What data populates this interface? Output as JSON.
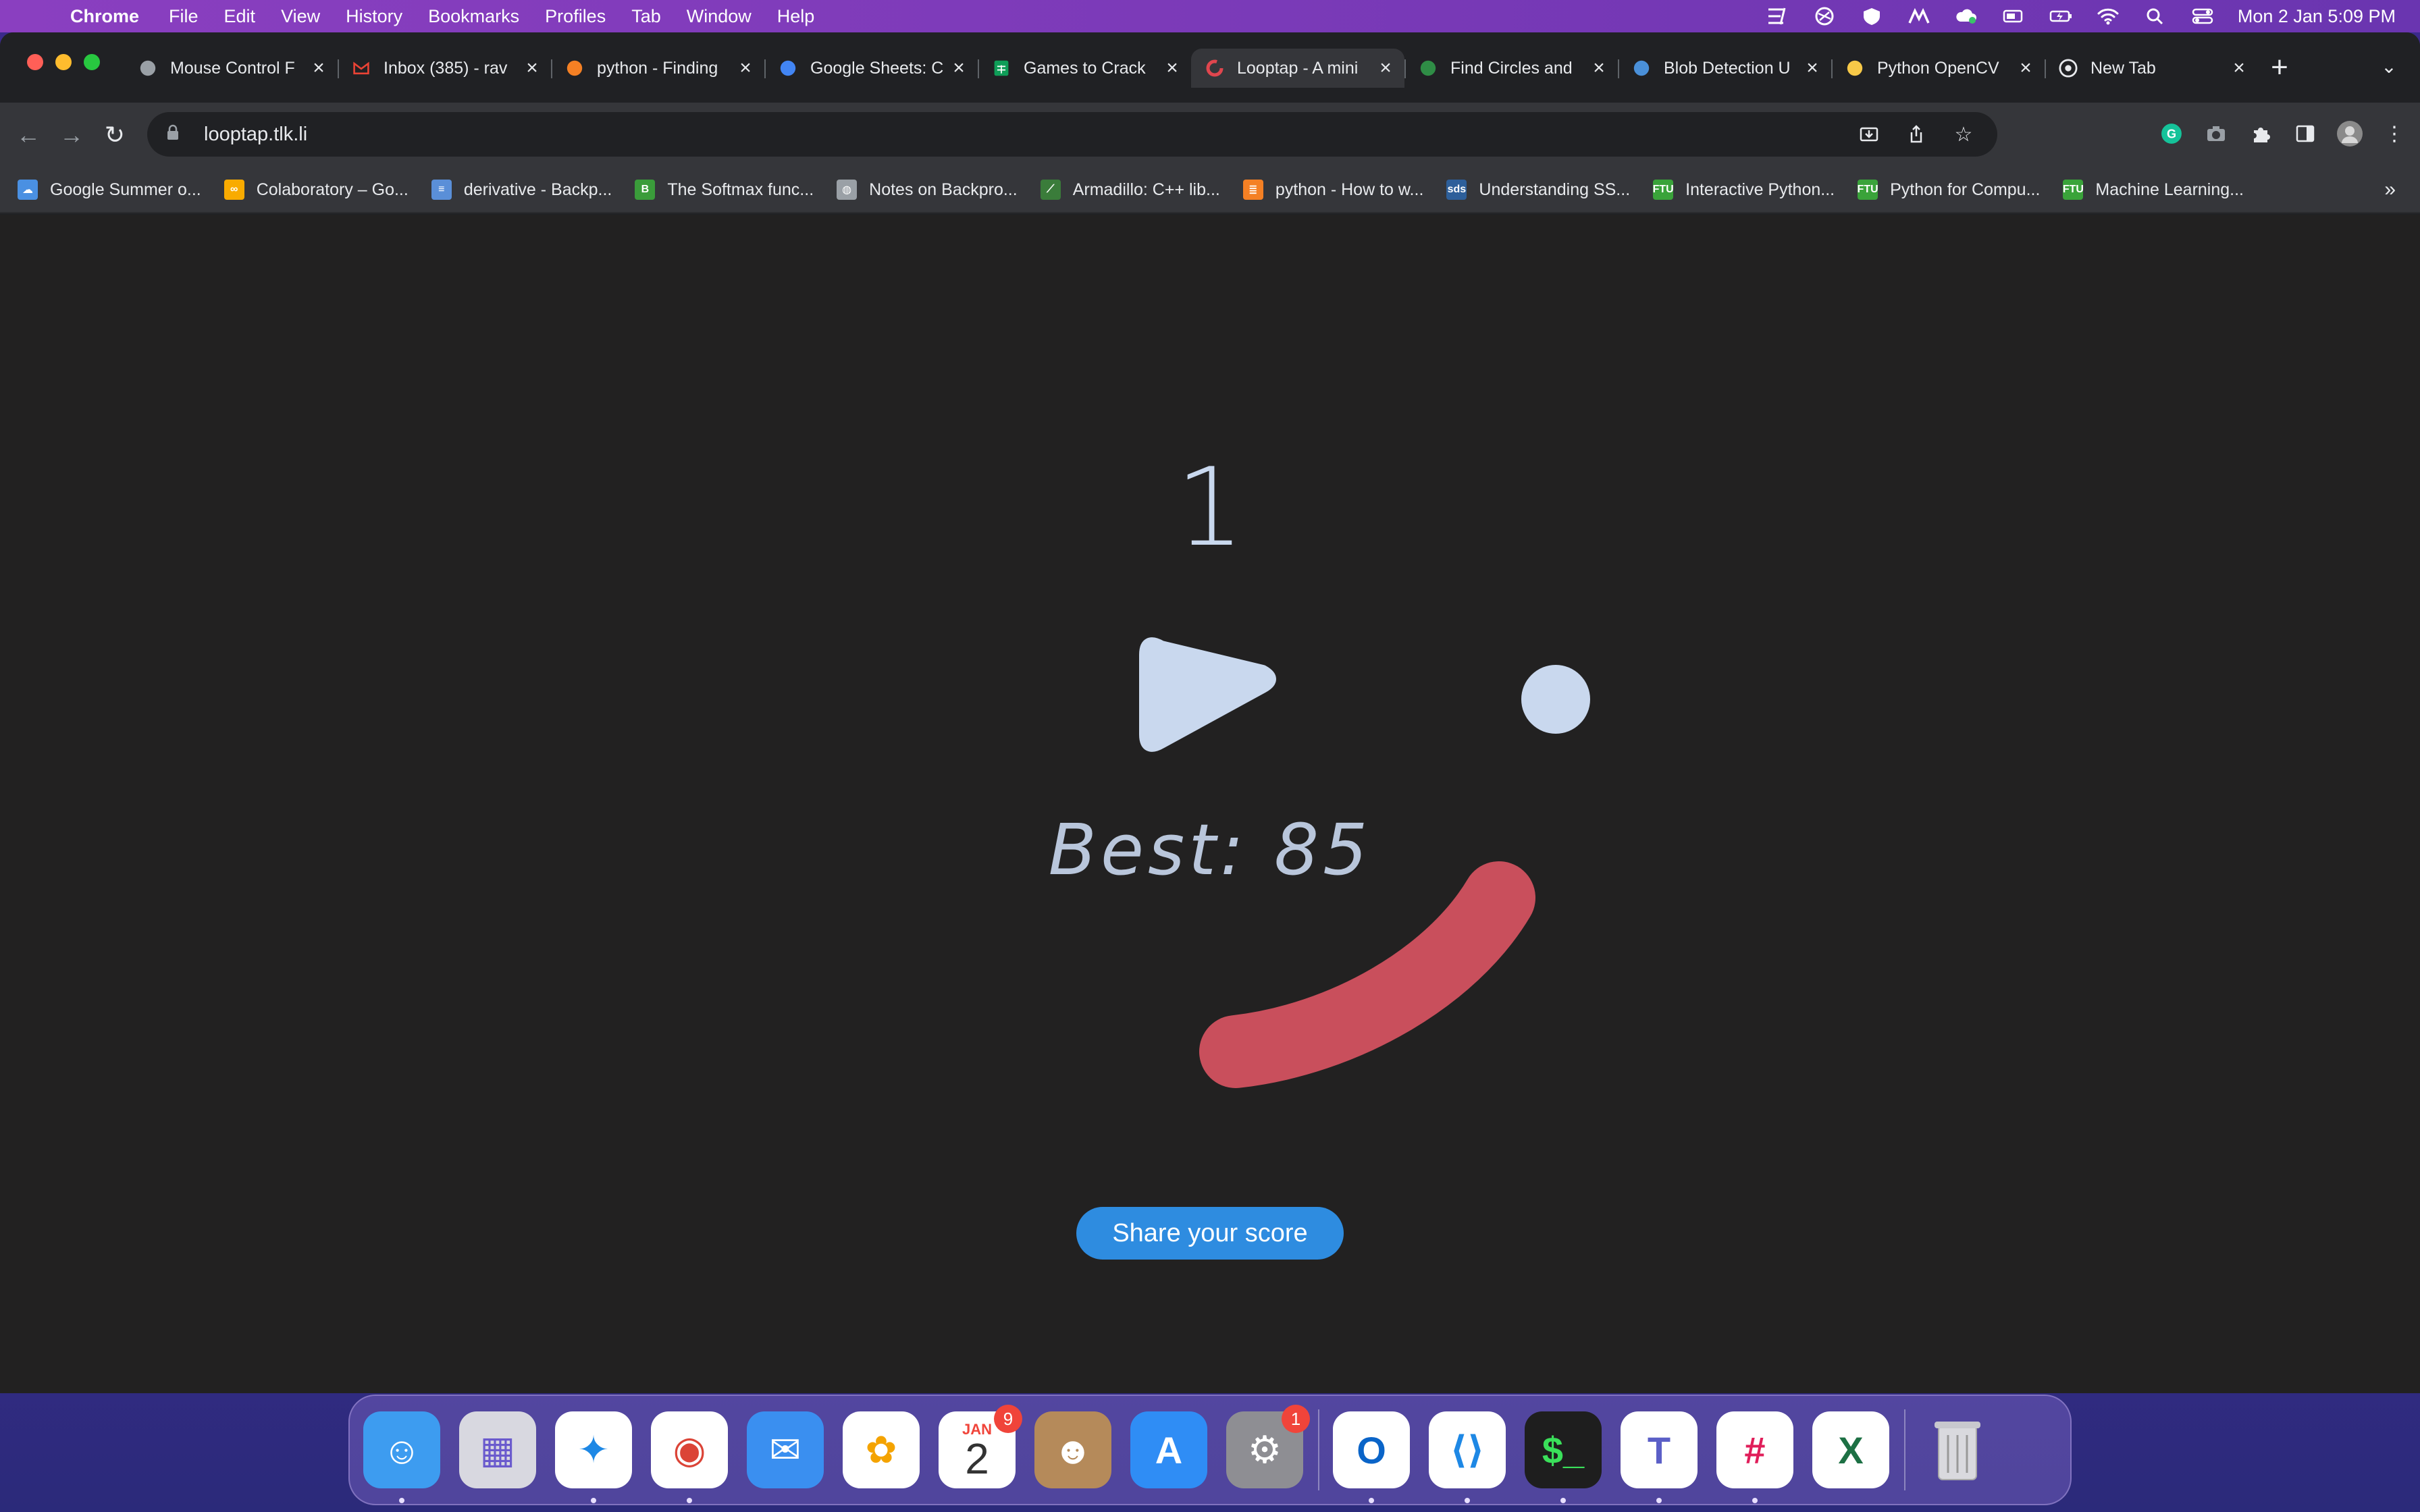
{
  "menubar": {
    "app": "Chrome",
    "items": [
      "File",
      "Edit",
      "View",
      "History",
      "Bookmarks",
      "Profiles",
      "Tab",
      "Window",
      "Help"
    ],
    "datetime": "Mon 2 Jan  5:09 PM"
  },
  "tabs": [
    {
      "title": "Mouse Control F",
      "favicon": "document-icon",
      "color": "#9aa0a6"
    },
    {
      "title": "Inbox (385) - rav",
      "favicon": "gmail-icon",
      "color": "#ea4335"
    },
    {
      "title": "python - Finding",
      "favicon": "stackoverflow-icon",
      "color": "#f48024"
    },
    {
      "title": "Google Sheets: C",
      "favicon": "google-icon",
      "color": "#4285f4"
    },
    {
      "title": "Games to Crack",
      "favicon": "sheets-icon",
      "color": "#0f9d58"
    },
    {
      "title": "Looptap - A mini",
      "favicon": "looptap-icon",
      "color": "#e0464e",
      "active": true
    },
    {
      "title": "Find Circles and",
      "favicon": "geeks-icon",
      "color": "#2f8d46"
    },
    {
      "title": "Blob Detection U",
      "favicon": "blob-icon",
      "color": "#4a90d9"
    },
    {
      "title": "Python OpenCV",
      "favicon": "python-icon",
      "color": "#f7c948"
    },
    {
      "title": "New Tab",
      "favicon": "chrome-icon",
      "color": "#9aa0a6"
    }
  ],
  "address": {
    "url": "looptap.tlk.li"
  },
  "bookmarks": [
    {
      "label": "Google Summer o...",
      "icon": "cloud-icon",
      "color": "#4a90e2",
      "glyph": "☁"
    },
    {
      "label": "Colaboratory – Go...",
      "icon": "colab-icon",
      "color": "#f9ab00",
      "glyph": "∞"
    },
    {
      "label": "derivative - Backp...",
      "icon": "stackexchange-icon",
      "color": "#5a8fd8",
      "glyph": "≡"
    },
    {
      "label": "The Softmax func...",
      "icon": "b-icon",
      "color": "#3a9c3a",
      "glyph": "B"
    },
    {
      "label": "Notes on Backpro...",
      "icon": "globe-icon",
      "color": "#9aa0a6",
      "glyph": "◍"
    },
    {
      "label": "Armadillo: C++ lib...",
      "icon": "armadillo-icon",
      "color": "#3a7c3a",
      "glyph": "⟋"
    },
    {
      "label": "python - How to w...",
      "icon": "stackoverflow-icon",
      "color": "#f48024",
      "glyph": "≣"
    },
    {
      "label": "Understanding SS...",
      "icon": "sds-icon",
      "color": "#2d5f9a",
      "glyph": "sds"
    },
    {
      "label": "Interactive Python...",
      "icon": "ftu-icon",
      "color": "#3aa33a",
      "glyph": "FTU"
    },
    {
      "label": "Python for Compu...",
      "icon": "ftu-icon",
      "color": "#3aa33a",
      "glyph": "FTU"
    },
    {
      "label": "Machine Learning...",
      "icon": "ftu-icon",
      "color": "#3aa33a",
      "glyph": "FTU"
    }
  ],
  "bookmarks_more": "»",
  "game": {
    "score": "1",
    "best": "Best: 85",
    "share_label": "Share your score",
    "colors": {
      "background": "#222121",
      "shape": "#c9d8ee",
      "arc": "#c94f5c",
      "button": "#2e8ce0"
    }
  },
  "dock": {
    "apps": [
      {
        "name": "finder-icon",
        "bg": "#3d9cf0"
      },
      {
        "name": "launchpad-icon",
        "bg": "#d8d8e0"
      },
      {
        "name": "safari-icon",
        "bg": "#ffffff"
      },
      {
        "name": "chrome-icon",
        "bg": "#ffffff"
      },
      {
        "name": "mail-icon",
        "bg": "#3a8ff0"
      },
      {
        "name": "photos-icon",
        "bg": "#ffffff"
      },
      {
        "name": "calendar-icon",
        "bg": "#ffffff",
        "month": "JAN",
        "day": "2",
        "badge": "9"
      },
      {
        "name": "contacts-icon",
        "bg": "#b58a5a"
      },
      {
        "name": "appstore-icon",
        "bg": "#2f8df5"
      },
      {
        "name": "settings-icon",
        "bg": "#8e8e93",
        "badge": "1"
      },
      {
        "name": "outlook-icon",
        "bg": "#ffffff"
      },
      {
        "name": "vscode-icon",
        "bg": "#ffffff"
      },
      {
        "name": "terminal-icon",
        "bg": "#1e1e1e"
      },
      {
        "name": "teams-icon",
        "bg": "#ffffff"
      },
      {
        "name": "slack-icon",
        "bg": "#ffffff"
      },
      {
        "name": "excel-icon",
        "bg": "#ffffff"
      }
    ],
    "trash": "trash-icon"
  }
}
